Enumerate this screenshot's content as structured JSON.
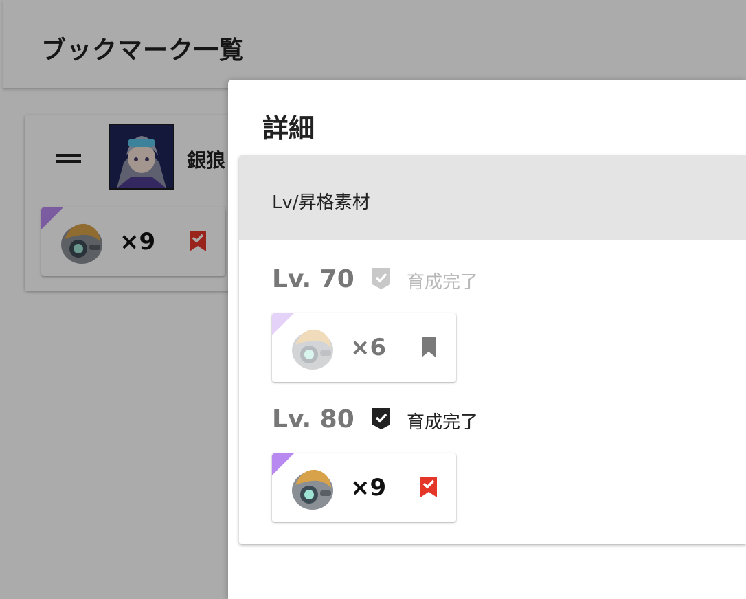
{
  "page": {
    "title": "ブックマーク一覧"
  },
  "bookmark_card": {
    "character_name": "銀狼",
    "material": {
      "quantity": "×9",
      "rarity_color": "#b889f0",
      "bookmark_color": "#e4372a",
      "icon": "helmet-material-icon"
    }
  },
  "dialog": {
    "title": "詳細",
    "section_header": "Lv/昇格素材",
    "levels": [
      {
        "level": "Lv. 70",
        "status": "育成完了",
        "checked": false,
        "quantity": "×6",
        "bookmarked": false
      },
      {
        "level": "Lv. 80",
        "status": "育成完了",
        "checked": true,
        "quantity": "×9",
        "bookmarked": true
      }
    ]
  },
  "colors": {
    "accent_red": "#e4372a",
    "rarity_purple": "#b889f0",
    "check_dark": "#222222"
  }
}
